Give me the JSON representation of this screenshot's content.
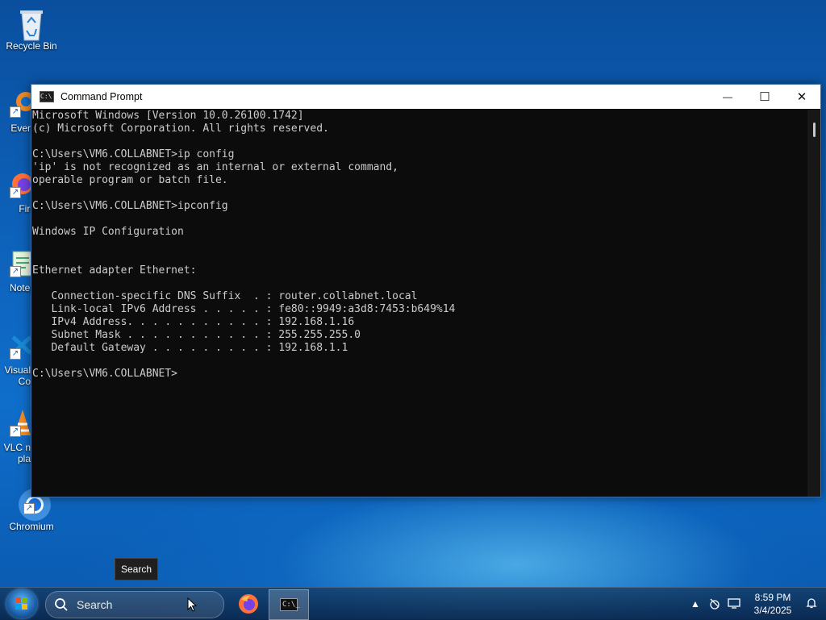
{
  "desktop": {
    "icons": [
      {
        "label": "Recycle Bin"
      },
      {
        "label": "Every"
      },
      {
        "label": "Fire"
      },
      {
        "label": "Notep"
      },
      {
        "label": "Visual Co"
      },
      {
        "label": "VLC n pla"
      },
      {
        "label": "Chromium"
      }
    ]
  },
  "window": {
    "title": "Command Prompt",
    "minimize_glyph": "—",
    "maximize_glyph": "☐",
    "close_glyph": "✕",
    "console_lines": [
      "Microsoft Windows [Version 10.0.26100.1742]",
      "(c) Microsoft Corporation. All rights reserved.",
      "",
      "C:\\Users\\VM6.COLLABNET>ip config",
      "'ip' is not recognized as an internal or external command,",
      "operable program or batch file.",
      "",
      "C:\\Users\\VM6.COLLABNET>ipconfig",
      "",
      "Windows IP Configuration",
      "",
      "",
      "Ethernet adapter Ethernet:",
      "",
      "   Connection-specific DNS Suffix  . : router.collabnet.local",
      "   Link-local IPv6 Address . . . . . : fe80::9949:a3d8:7453:b649%14",
      "   IPv4 Address. . . . . . . . . . . : 192.168.1.16",
      "   Subnet Mask . . . . . . . . . . . : 255.255.255.0",
      "   Default Gateway . . . . . . . . . : 192.168.1.1",
      "",
      "C:\\Users\\VM6.COLLABNET>"
    ]
  },
  "tooltip": {
    "text": "Search"
  },
  "taskbar": {
    "search_placeholder": "Search",
    "clock_time": "8:59 PM",
    "clock_date": "3/4/2025",
    "cmd_glyph": "C:\\_"
  }
}
